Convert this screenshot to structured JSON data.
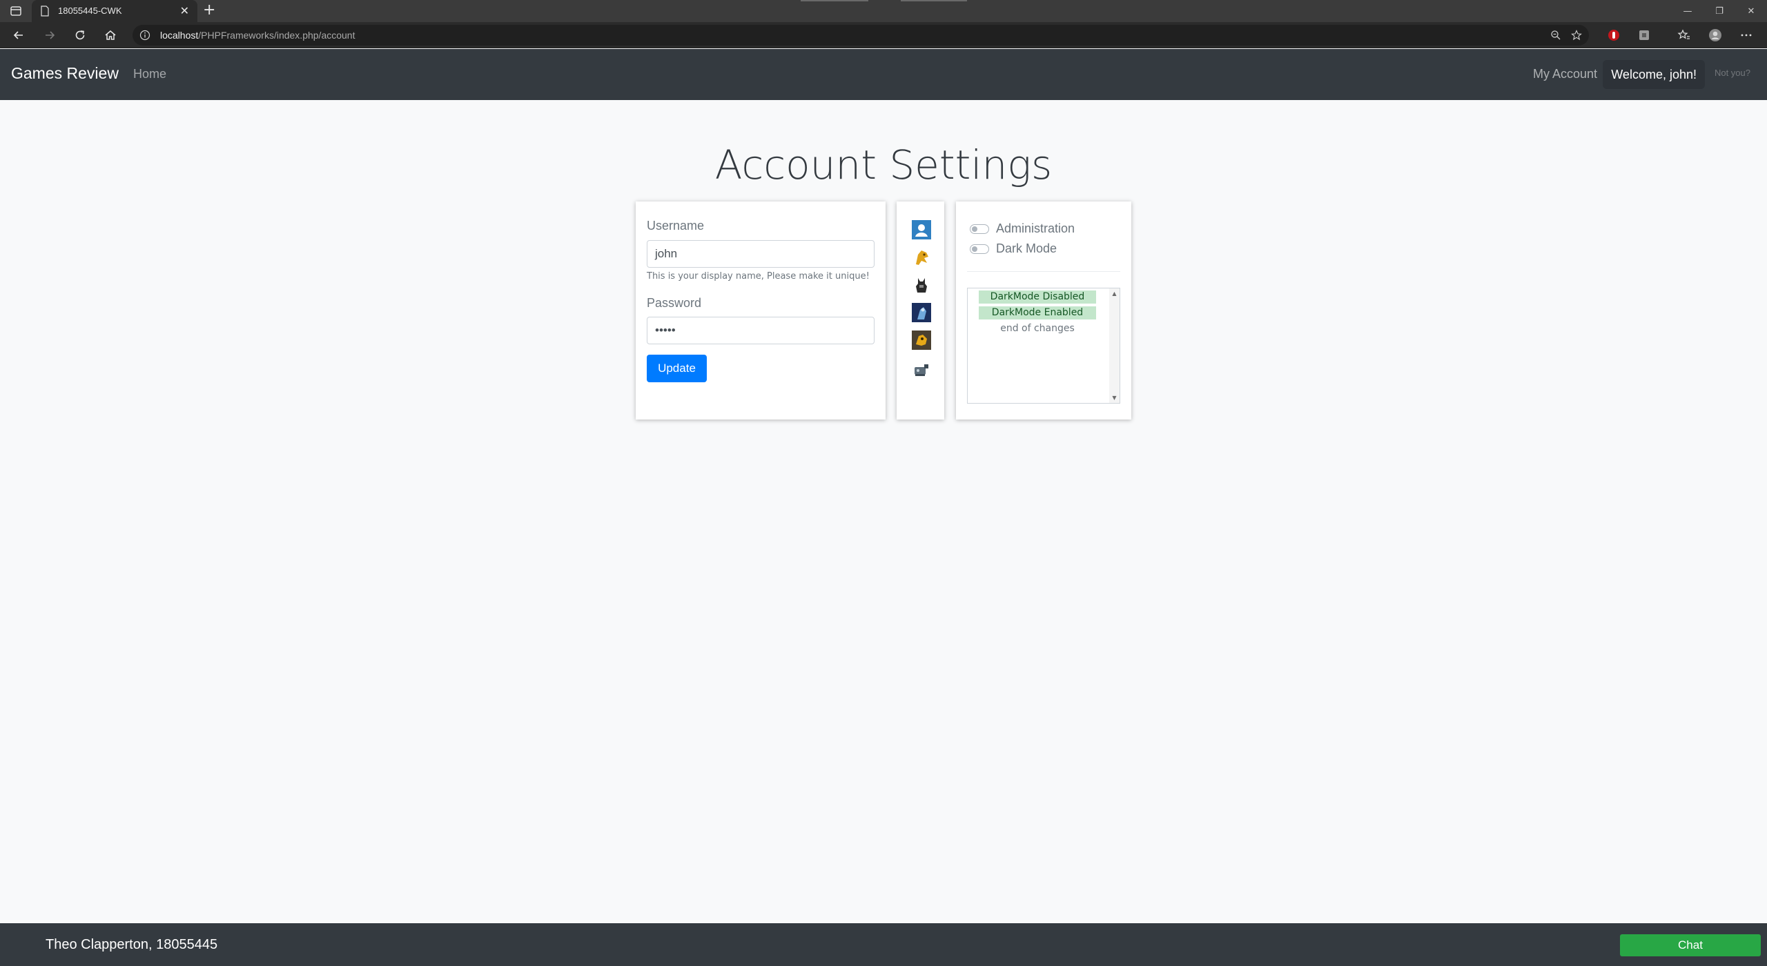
{
  "browser": {
    "tab_title": "18055445-CWK",
    "tab_close": "✕",
    "new_tab": "+",
    "url_host": "localhost",
    "url_path": "/PHPFrameworks/index.php/account",
    "window_controls": [
      "—",
      "❐",
      "✕"
    ]
  },
  "navbar": {
    "brand": "Games Review",
    "home": "Home",
    "my_account": "My Account",
    "welcome": "Welcome, john!",
    "not_you": "Not you?"
  },
  "main": {
    "title": "Account Settings",
    "form": {
      "username_label": "Username",
      "username_value": "john",
      "username_help": "This is your display name, Please make it unique!",
      "password_label": "Password",
      "password_value": "•••••",
      "update_label": "Update"
    },
    "avatars": [
      "default-user-avatar",
      "golden-creature-avatar",
      "dark-armored-avatar",
      "blue-warrior-avatar",
      "yellow-beast-avatar",
      "grey-robot-avatar"
    ],
    "settings": {
      "toggles": [
        {
          "label": "Administration",
          "on": false
        },
        {
          "label": "Dark Mode",
          "on": false
        }
      ],
      "log": [
        "DarkMode Disabled",
        "DarkMode Enabled",
        "end of changes"
      ]
    }
  },
  "footer": {
    "text": "Theo Clapperton, 18055445",
    "chat_label": "Chat"
  },
  "colors": {
    "navbar": "#343a40",
    "primary": "#007bff",
    "success": "#28a745",
    "log_highlight": "#c3e6cb",
    "page_bg": "#f8f9fa"
  }
}
